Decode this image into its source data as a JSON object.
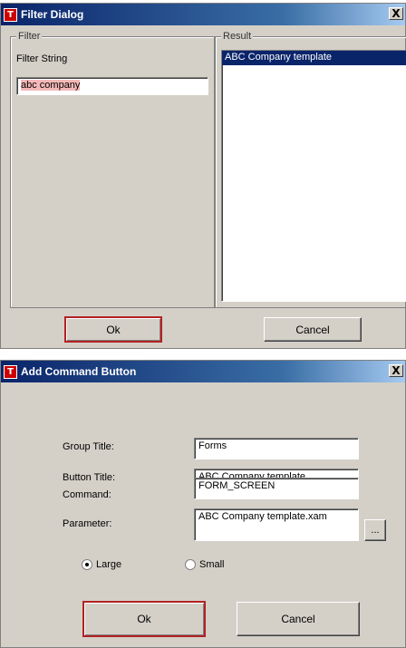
{
  "filter_dialog": {
    "title": "Filter Dialog",
    "app_icon_letter": "T",
    "close_glyph": "X",
    "filter_group_label": "Filter",
    "filter_string_label": "Filter String",
    "filter_input_value": "abc company",
    "result_group_label": "Result",
    "results": [
      "ABC Company template"
    ],
    "ok_label": "Ok",
    "cancel_label": "Cancel"
  },
  "add_command_dialog": {
    "title": "Add Command Button",
    "app_icon_letter": "T",
    "close_glyph": "X",
    "group_title_label": "Group Title:",
    "group_title_value": "Forms",
    "button_title_label": "Button Title:",
    "button_title_value": "ABC Company template",
    "command_label": "Command:",
    "command_value": "FORM_SCREEN",
    "parameter_label": "Parameter:",
    "parameter_value": "ABC Company template.xam",
    "browse_label": "...",
    "size_large_label": "Large",
    "size_small_label": "Small",
    "selected_size": "Large",
    "ok_label": "Ok",
    "cancel_label": "Cancel"
  },
  "colors": {
    "title_gradient_start": "#0a246a",
    "filter_highlight": "#f4b8b8",
    "selection": "#0a246a",
    "default_button_border": "#b22222"
  }
}
